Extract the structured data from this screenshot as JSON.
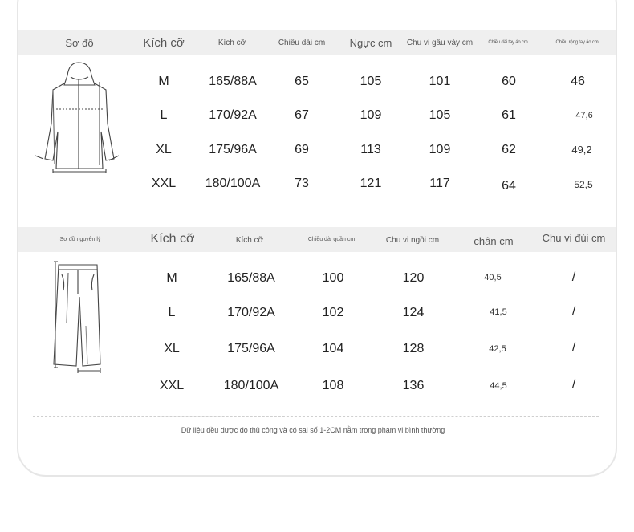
{
  "top_table": {
    "headers": [
      "Sơ đồ",
      "Kích cỡ",
      "Kích cỡ",
      "Chiều dài cm",
      "Ngực cm",
      "Chu vi gấu váy cm",
      "Chiều dài tay áo cm",
      "Chiều rộng tay áo cm"
    ],
    "rows": [
      [
        "M",
        "165/88A",
        "65",
        "105",
        "101",
        "60",
        "46"
      ],
      [
        "L",
        "170/92A",
        "67",
        "109",
        "105",
        "61",
        "47,6"
      ],
      [
        "XL",
        "175/96A",
        "69",
        "113",
        "109",
        "62",
        "49,2"
      ],
      [
        "XXL",
        "180/100A",
        "73",
        "121",
        "117",
        "64",
        "52,5"
      ]
    ]
  },
  "bottom_table": {
    "headers": [
      "Sơ đồ nguyên lý",
      "Kích cỡ",
      "Kích cỡ",
      "Chiều dài quần cm",
      "Chu vi ngồi cm",
      "chân cm",
      "Chu vi đùi cm"
    ],
    "rows": [
      [
        "M",
        "165/88A",
        "100",
        "120",
        "40,5",
        "/"
      ],
      [
        "L",
        "170/92A",
        "102",
        "124",
        "41,5",
        "/"
      ],
      [
        "XL",
        "175/96A",
        "104",
        "128",
        "42,5",
        "/"
      ],
      [
        "XXL",
        "180/100A",
        "108",
        "136",
        "44,5",
        "/"
      ]
    ]
  },
  "footnote": "Dữ liệu đều được đo thủ công và có sai số 1-2CM nằm trong phạm vi bình thường",
  "colors": {
    "header_bg": "#efefef",
    "card_border": "#e6e6e6",
    "text": "#222222"
  },
  "icons": {
    "top_diagram": "hoodie-jacket-diagram",
    "bottom_diagram": "pants-diagram"
  }
}
